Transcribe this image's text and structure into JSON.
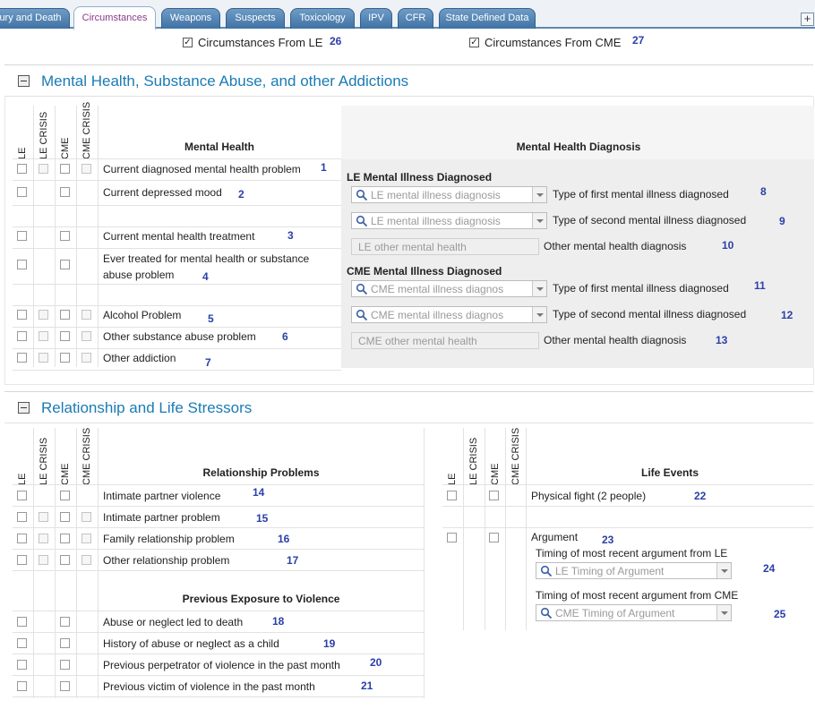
{
  "tabs": [
    {
      "label": "ury and Death"
    },
    {
      "label": "Circumstances",
      "active": true
    },
    {
      "label": "Weapons"
    },
    {
      "label": "Suspects"
    },
    {
      "label": "Toxicology"
    },
    {
      "label": "IPV"
    },
    {
      "label": "CFR"
    },
    {
      "label": "State Defined Data"
    }
  ],
  "top_checks": {
    "le": {
      "label": "Circumstances From LE",
      "num": "26",
      "checked": true
    },
    "cme": {
      "label": "Circumstances From CME",
      "num": "27",
      "checked": true
    }
  },
  "column_labels": [
    "LE",
    "LE CRISIS",
    "CME",
    "CME CRISIS"
  ],
  "mental_health_section": {
    "title": "Mental Health, Substance Abuse, and other Addictions",
    "left_header": "Mental Health",
    "right_header": "Mental Health Diagnosis",
    "rows": [
      {
        "label": "Current diagnosed mental health problem",
        "num": "1"
      },
      {
        "label": "Current depressed mood",
        "num": "2"
      },
      {
        "label": "Current mental health treatment",
        "num": "3"
      },
      {
        "label": "Ever treated for mental health or substance abuse problem",
        "num": "4"
      },
      {
        "label": "Alcohol Problem",
        "num": "5"
      },
      {
        "label": "Other substance abuse problem",
        "num": "6"
      },
      {
        "label": "Other addiction",
        "num": "7"
      }
    ],
    "le_group": {
      "title": "LE Mental Illness Diagnosed",
      "first_placeholder": "LE mental illness diagnosis",
      "first_label": "Type of first mental illness diagnosed",
      "first_num": "8",
      "second_placeholder": "LE mental illness diagnosis",
      "second_label": "Type of second mental illness diagnosed",
      "second_num": "9",
      "other_placeholder": "LE other mental health",
      "other_label": "Other mental health diagnosis",
      "other_num": "10"
    },
    "cme_group": {
      "title": "CME Mental Illness Diagnosed",
      "first_placeholder": "CME mental illness diagnos",
      "first_label": "Type of first mental illness diagnosed",
      "first_num": "11",
      "second_placeholder": "CME mental illness diagnos",
      "second_label": "Type of second mental illness diagnosed",
      "second_num": "12",
      "other_placeholder": "CME other mental health",
      "other_label": "Other mental health diagnosis",
      "other_num": "13"
    }
  },
  "relationship_section": {
    "title": "Relationship and Life Stressors",
    "relationship_header": "Relationship Problems",
    "relationship_rows": [
      {
        "label": "Intimate partner violence",
        "num": "14"
      },
      {
        "label": "Intimate partner problem",
        "num": "15"
      },
      {
        "label": "Family relationship problem",
        "num": "16"
      },
      {
        "label": "Other relationship problem",
        "num": "17"
      }
    ],
    "violence_header": "Previous Exposure to Violence",
    "violence_rows": [
      {
        "label": "Abuse or neglect led to death",
        "num": "18"
      },
      {
        "label": "History of abuse or neglect as a child",
        "num": "19"
      },
      {
        "label": "Previous perpetrator of violence in the past month",
        "num": "20"
      },
      {
        "label": "Previous victim of violence in the past month",
        "num": "21"
      }
    ],
    "life_header": "Life Events",
    "fight": {
      "label": "Physical fight (2 people)",
      "num": "22"
    },
    "argument": {
      "label": "Argument",
      "num": "23",
      "le_label": "Timing of most recent argument from LE",
      "le_placeholder": "LE Timing of Argument",
      "le_num": "24",
      "cme_label": "Timing of most recent argument from CME",
      "cme_placeholder": "CME Timing of Argument",
      "cme_num": "25"
    }
  }
}
